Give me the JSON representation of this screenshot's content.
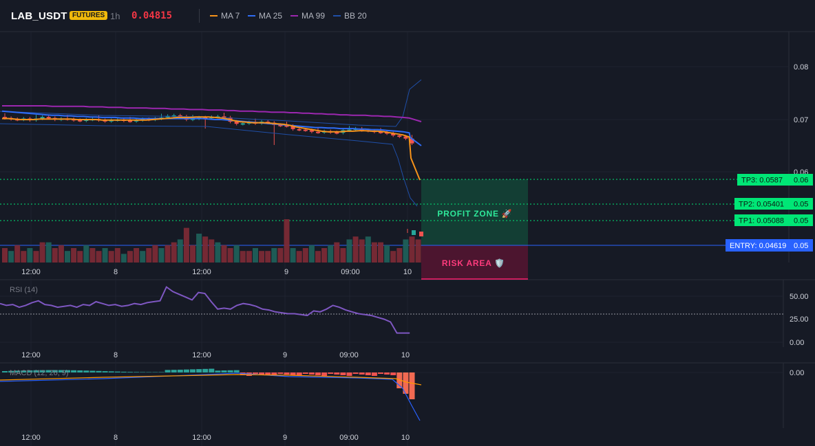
{
  "header": {
    "symbol": "LAB_USDT",
    "badge": "FUTURES",
    "timeframe": "1h",
    "last_price": "0.04815",
    "legend": [
      {
        "label": "MA 7",
        "color": "#f7931a"
      },
      {
        "label": "MA 25",
        "color": "#2f6df6"
      },
      {
        "label": "MA 99",
        "color": "#9c27b0"
      },
      {
        "label": "BB 20",
        "color": "#1f4fa8"
      }
    ]
  },
  "colors": {
    "up": "#26a69a",
    "down": "#ef5350",
    "tp": "#00e676",
    "entry": "#2962ff",
    "risk": "#ff1f6e",
    "rsi": "#7e57c2"
  },
  "price_axis": [
    "0.08",
    "0.07",
    "0.06",
    "0.05",
    "0.05",
    "0.05",
    "0.05"
  ],
  "levels": {
    "tp3": {
      "label": "TP3: 0.0587",
      "axis": "0.06"
    },
    "tp2": {
      "label": "TP2: 0.05401",
      "axis": "0.05"
    },
    "tp1": {
      "label": "TP1: 0.05088",
      "axis": "0.05"
    },
    "entry": {
      "label": "ENTRY: 0.04619",
      "axis": "0.05"
    }
  },
  "zones": {
    "profit": "PROFIT ZONE 🚀",
    "risk": "RISK AREA 🛡️"
  },
  "time_axis": [
    "12:00",
    "8",
    "12:00",
    "9",
    "09:00",
    "10"
  ],
  "rsi": {
    "label": "RSI (14)",
    "axis": [
      "50.00",
      "25.00",
      "0.00"
    ]
  },
  "macd": {
    "label": "MACD (12, 26, 9)",
    "axis": [
      "0.00"
    ]
  },
  "chart_data": {
    "type": "candlestick",
    "symbol": "LAB_USDT",
    "interval": "1h",
    "ylim": [
      0.046,
      0.087
    ],
    "x_ticks": [
      "12:00",
      "8",
      "12:00",
      "9",
      "09:00",
      "10"
    ],
    "close": [
      0.0703,
      0.0701,
      0.07,
      0.0702,
      0.0699,
      0.0702,
      0.0705,
      0.0703,
      0.07,
      0.0702,
      0.0701,
      0.0699,
      0.0698,
      0.07,
      0.0701,
      0.0699,
      0.0697,
      0.0699,
      0.07,
      0.0698,
      0.0697,
      0.0699,
      0.0701,
      0.07,
      0.0702,
      0.0704,
      0.0707,
      0.0708,
      0.0706,
      0.07,
      0.0702,
      0.0704,
      0.0703,
      0.0705,
      0.0706,
      0.0704,
      0.0696,
      0.0692,
      0.0693,
      0.0695,
      0.0693,
      0.0696,
      0.0694,
      0.069,
      0.0689,
      0.0688,
      0.0682,
      0.0681,
      0.068,
      0.0677,
      0.0676,
      0.0678,
      0.0676,
      0.0675,
      0.068,
      0.0681,
      0.0683,
      0.068,
      0.0679,
      0.0677,
      0.0676,
      0.0674,
      0.067,
      0.0668,
      0.0664,
      0.0655
    ],
    "ma7": [
      0.0702,
      0.0702,
      0.0701,
      0.07,
      0.07,
      0.07,
      0.0701,
      0.0701,
      0.0701,
      0.0701,
      0.0701,
      0.0701,
      0.07,
      0.07,
      0.07,
      0.07,
      0.0699,
      0.0699,
      0.0699,
      0.0699,
      0.0699,
      0.0699,
      0.0699,
      0.0699,
      0.07,
      0.0701,
      0.0702,
      0.0703,
      0.0704,
      0.0704,
      0.0704,
      0.0705,
      0.0705,
      0.0705,
      0.0704,
      0.0703,
      0.0701,
      0.0698,
      0.0696,
      0.0695,
      0.0694,
      0.0694,
      0.0694,
      0.0693,
      0.0692,
      0.0691,
      0.0689,
      0.0686,
      0.0684,
      0.0682,
      0.068,
      0.0678,
      0.0677,
      0.0677,
      0.0677,
      0.0678,
      0.0678,
      0.0679,
      0.0679,
      0.0678,
      0.0678,
      0.0677,
      0.0675,
      0.0673,
      0.0671,
      0.0667,
      0.0586
    ],
    "ma25": [
      0.0716,
      0.0715,
      0.0714,
      0.0713,
      0.0712,
      0.0711,
      0.071,
      0.0709,
      0.0708,
      0.0708,
      0.0707,
      0.0707,
      0.0706,
      0.0706,
      0.0705,
      0.0705,
      0.0704,
      0.0704,
      0.0704,
      0.0703,
      0.0703,
      0.0703,
      0.0702,
      0.0702,
      0.0702,
      0.0702,
      0.0702,
      0.0702,
      0.0702,
      0.0702,
      0.0702,
      0.0702,
      0.0702,
      0.0701,
      0.07,
      0.07,
      0.0699,
      0.0698,
      0.0697,
      0.0696,
      0.0695,
      0.0694,
      0.0693,
      0.0692,
      0.0691,
      0.069,
      0.0689,
      0.0688,
      0.0687,
      0.0686,
      0.0685,
      0.0685,
      0.0684,
      0.0684,
      0.0683,
      0.0683,
      0.0683,
      0.0682,
      0.0682,
      0.0681,
      0.0681,
      0.068,
      0.0679,
      0.0678,
      0.0677,
      0.0675,
      0.0654
    ],
    "ma99": [
      0.0726,
      0.0726,
      0.0726,
      0.0726,
      0.0726,
      0.0726,
      0.0726,
      0.0726,
      0.0725,
      0.0725,
      0.0725,
      0.0725,
      0.0725,
      0.0725,
      0.0724,
      0.0724,
      0.0724,
      0.0723,
      0.0723,
      0.0723,
      0.0722,
      0.0722,
      0.0722,
      0.0722,
      0.0721,
      0.0721,
      0.0721,
      0.072,
      0.072,
      0.072,
      0.0719,
      0.0719,
      0.0719,
      0.0718,
      0.0718,
      0.0718,
      0.0717,
      0.0717,
      0.0716,
      0.0716,
      0.0716,
      0.0715,
      0.0715,
      0.0714,
      0.0714,
      0.0714,
      0.0713,
      0.0713,
      0.0712,
      0.0712,
      0.0711,
      0.0711,
      0.071,
      0.071,
      0.0709,
      0.0709,
      0.0708,
      0.0708,
      0.0708,
      0.0707,
      0.0707,
      0.0706,
      0.0706,
      0.0705,
      0.0704,
      0.0703,
      0.0697
    ],
    "levels": {
      "tp3": 0.0587,
      "tp2": 0.05401,
      "tp1": 0.05088,
      "entry": 0.04619
    },
    "volume": [
      5,
      4,
      6,
      4,
      5,
      4,
      7,
      7,
      5,
      6,
      4,
      5,
      4,
      6,
      5,
      4,
      5,
      4,
      5,
      3,
      4,
      5,
      4,
      5,
      6,
      5,
      6,
      7,
      8,
      12,
      6,
      10,
      9,
      8,
      7,
      6,
      5,
      6,
      4,
      4,
      5,
      4,
      4,
      5,
      5,
      15,
      5,
      4,
      5,
      6,
      4,
      5,
      6,
      7,
      5,
      8,
      9,
      8,
      9,
      7,
      7,
      6,
      4,
      5,
      8,
      9,
      8
    ]
  }
}
